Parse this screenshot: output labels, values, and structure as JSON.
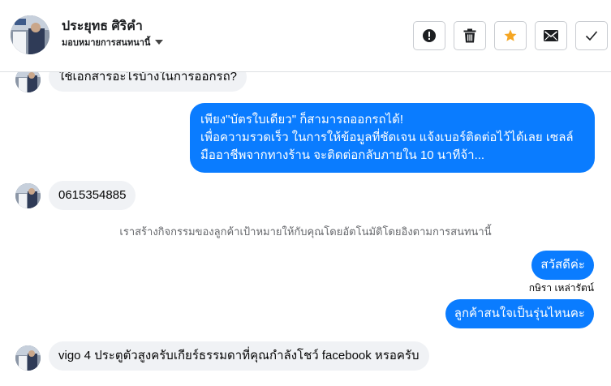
{
  "header": {
    "contact_name": "ประยุทธ ศิริคำ",
    "assign_label": "มอบหมายการสนทนานี้",
    "actions": [
      {
        "name": "report-button",
        "icon": "alert-circle-icon"
      },
      {
        "name": "delete-button",
        "icon": "trash-icon"
      },
      {
        "name": "star-button",
        "icon": "star-icon",
        "color": "#f5a623"
      },
      {
        "name": "mark-unread-button",
        "icon": "envelope-icon"
      },
      {
        "name": "done-button",
        "icon": "checkmark-icon"
      }
    ]
  },
  "messages": {
    "m1": "ใช้เอกสารอะไรบ้างในการออกรถ?",
    "m2_lines": [
      "เพียง\"บัตรใบเดียว\" ก็สามารถออกรถได้!",
      "เพื่อความรวดเร็ว ในการให้ข้อมูลที่ชัดเจน แจ้งเบอร์ติดต่อไว้ได้เลย เซลล์",
      "มืออาชีพจากทางร้าน จะติดต่อกลับภายใน 10 นาทีจ้า..."
    ],
    "m3": "0615354885",
    "system_note": "เราสร้างกิจกรรมของลูกค้าเป้าหมายให้กับคุณโดยอัตโนมัติโดยอิงตามการสนทนานี้",
    "m4": "สวัสดีค่ะ",
    "agent_name": "กษิรา เหล่ารัตน์",
    "m5": "ลูกค้าสนใจเป็นรุ่นไหนคะ",
    "m6": "vigo 4 ประตูตัวสูงครับเกียร์ธรรมดาที่คุณกำลังโชว์ facebook หรอครับ"
  },
  "colors": {
    "outgoing_bubble": "#0a7cff",
    "incoming_bubble": "#f0f2f5",
    "star": "#f5a623"
  }
}
